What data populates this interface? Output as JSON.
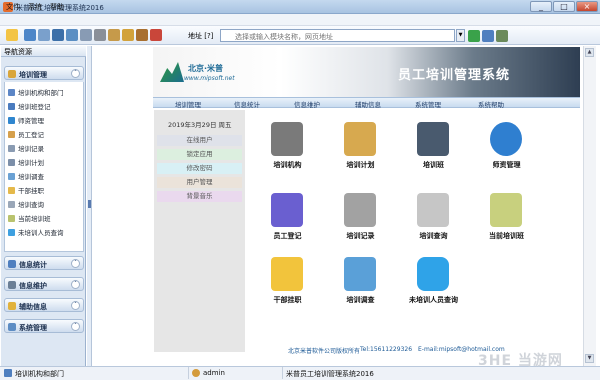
{
  "window": {
    "title": "米普员工培训管理系统2016",
    "colors": {
      "accent": "#2e6fb7",
      "chrome": "#c4d9ef",
      "banner_dark": "#2e3e52"
    }
  },
  "menubar": {
    "items": [
      "文件",
      "系统",
      "帮助"
    ]
  },
  "toolbar": {
    "buttons": [
      "back-icon",
      "open-icon",
      "home-icon",
      "user-card-icon",
      "info-icon",
      "calendar-icon",
      "print-icon",
      "tools-icon",
      "lock-icon",
      "key-icon",
      "exit-icon"
    ],
    "address_label": "地址",
    "address_hint": "选择或输入模块名称，网页地址",
    "address_suffix": "[?]"
  },
  "left_panel": {
    "title": "导航资源",
    "groups": [
      {
        "label": "培训管理",
        "icon": "folder-icon"
      },
      {
        "label": "信息统计",
        "icon": "chart-icon"
      },
      {
        "label": "信息维护",
        "icon": "wrench-icon"
      },
      {
        "label": "辅助信息",
        "icon": "star-icon"
      },
      {
        "label": "系统管理",
        "icon": "gear-icon"
      }
    ],
    "items": [
      "培训机构和部门",
      "培训班登记",
      "师资管理",
      "员工登记",
      "培训记录",
      "培训计划",
      "培训调查",
      "干部挂职",
      "培训查询",
      "当前培训班",
      "未培训人员查询"
    ]
  },
  "banner": {
    "logo_name": "北京·米普",
    "logo_url": "www.mipsoft.net",
    "heading": "员工培训管理系统"
  },
  "top_nav": [
    "培训管理",
    "信息统计",
    "信息维护",
    "辅助信息",
    "系统管理",
    "系统帮助"
  ],
  "side": {
    "date": "2019年3月29日 周五",
    "buttons": [
      "在线用户",
      "锁定应用",
      "修改密码",
      "用户管理",
      "背景音乐"
    ],
    "button_colors": [
      "#dfe2ea",
      "#dcefdf",
      "#d8f0f5",
      "#ebe3da",
      "#ead9ee"
    ]
  },
  "tiles": [
    {
      "label": "培训机构",
      "icon": "building-icon",
      "color": "#7a7a7a"
    },
    {
      "label": "培训计划",
      "icon": "calendar-clock-icon",
      "color": "#d7a94f"
    },
    {
      "label": "培训班",
      "icon": "folder-class-icon",
      "color": "#495a6e"
    },
    {
      "label": "师资管理",
      "icon": "teachers-icon",
      "color": "#2f7fd0"
    },
    {
      "label": "员工登记",
      "icon": "finder-icon",
      "color": "#6a5fd0"
    },
    {
      "label": "培训记录",
      "icon": "records-icon",
      "color": "#a2a2a2"
    },
    {
      "label": "培训查询",
      "icon": "search-doc-icon",
      "color": "#c6c6c6"
    },
    {
      "label": "当前培训班",
      "icon": "current-class-icon",
      "color": "#c8d07e"
    },
    {
      "label": "干部挂职",
      "icon": "star-doc-icon",
      "color": "#f2c43c"
    },
    {
      "label": "培训调查",
      "icon": "survey-folder-icon",
      "color": "#5aa0d8"
    },
    {
      "label": "未培训人员查询",
      "icon": "users-icon",
      "color": "#2fa3e8"
    }
  ],
  "footer": {
    "company": "北京米普软件公司版权所有",
    "phone": "Tel:15611229326",
    "email": "E-mail:mipsoft@hotmail.com"
  },
  "statusbar": {
    "left": "培训机构和部门",
    "user": "admin",
    "app": "米普员工培训管理系统2016"
  },
  "watermark": "3HE 当游网"
}
